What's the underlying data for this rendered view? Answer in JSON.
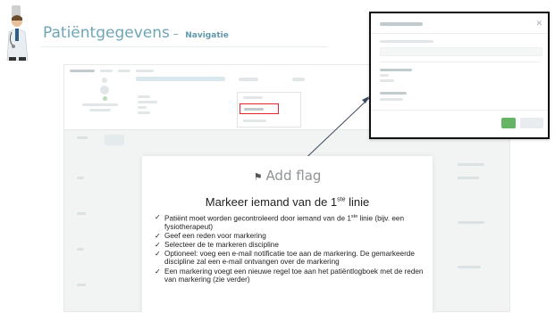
{
  "slide": {
    "title": "Patiëntgegevens",
    "separator": "–",
    "subtitle": "Navigatie"
  },
  "card": {
    "header_icon": "flag-icon",
    "header_label": "Add flag",
    "title_pre": "Markeer iemand van de 1",
    "title_sup": "ste",
    "title_post": " linie",
    "bullets": [
      {
        "pre": "Patiënt moet worden gecontroleerd door iemand van de 1",
        "sup": "ste",
        "post": " linie (bijv. een fysiotherapeut)"
      },
      {
        "pre": "Geef een reden voor markering",
        "sup": "",
        "post": ""
      },
      {
        "pre": "Selecteer de te markeren discipline",
        "sup": "",
        "post": ""
      },
      {
        "pre": "Optioneel: voeg een e-mail notificatie toe aan de markering. De gemarkeerde discipline zal een e-mail ontvangen over de markering",
        "sup": "",
        "post": ""
      },
      {
        "pre": "Een markering voegt een nieuwe regel toe aan het patiëntlogboek met de reden van markering (zie verder)",
        "sup": "",
        "post": ""
      }
    ],
    "check_glyph": "✓"
  },
  "colors": {
    "title": "#6fa6b7",
    "highlight": "#e0252b",
    "modal_border": "#111111",
    "ok_button": "#4aa84a"
  }
}
